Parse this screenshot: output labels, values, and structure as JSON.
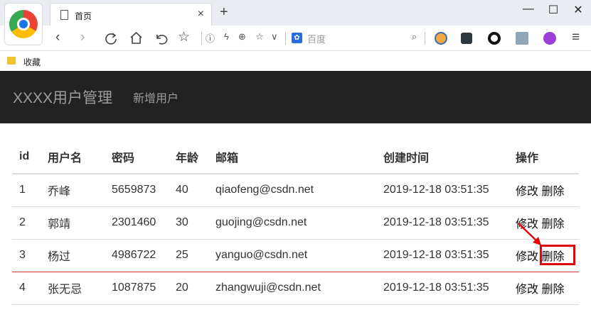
{
  "browser": {
    "tab_title": "首页",
    "tab_close": "×",
    "new_tab": "+",
    "win_min": "—",
    "win_max": "☐",
    "win_close": "✕",
    "search_placeholder": "百度",
    "baidu_badge": "✿",
    "bookmark_folder": "收藏"
  },
  "navbar": {
    "brand": "XXXX用户管理",
    "add_user": "新增用户"
  },
  "table": {
    "headers": [
      "id",
      "用户名",
      "密码",
      "年龄",
      "邮箱",
      "创建时间",
      "操作"
    ],
    "rows": [
      {
        "id": "1",
        "name": "乔峰",
        "password": "5659873",
        "age": "40",
        "email": "qiaofeng@csdn.net",
        "created": "2019-12-18 03:51:35"
      },
      {
        "id": "2",
        "name": "郭靖",
        "password": "2301460",
        "age": "30",
        "email": "guojing@csdn.net",
        "created": "2019-12-18 03:51:35"
      },
      {
        "id": "3",
        "name": "杨过",
        "password": "4986722",
        "age": "25",
        "email": "yanguo@csdn.net",
        "created": "2019-12-18 03:51:35"
      },
      {
        "id": "4",
        "name": "张无忌",
        "password": "1087875",
        "age": "20",
        "email": "zhangwuji@csdn.net",
        "created": "2019-12-18 03:51:35"
      }
    ],
    "edit_label": "修改",
    "delete_label": "删除"
  },
  "colors": {
    "navbar_bg": "#222222",
    "navbar_text": "#9d9d9d",
    "annotation": "#e0040a"
  }
}
